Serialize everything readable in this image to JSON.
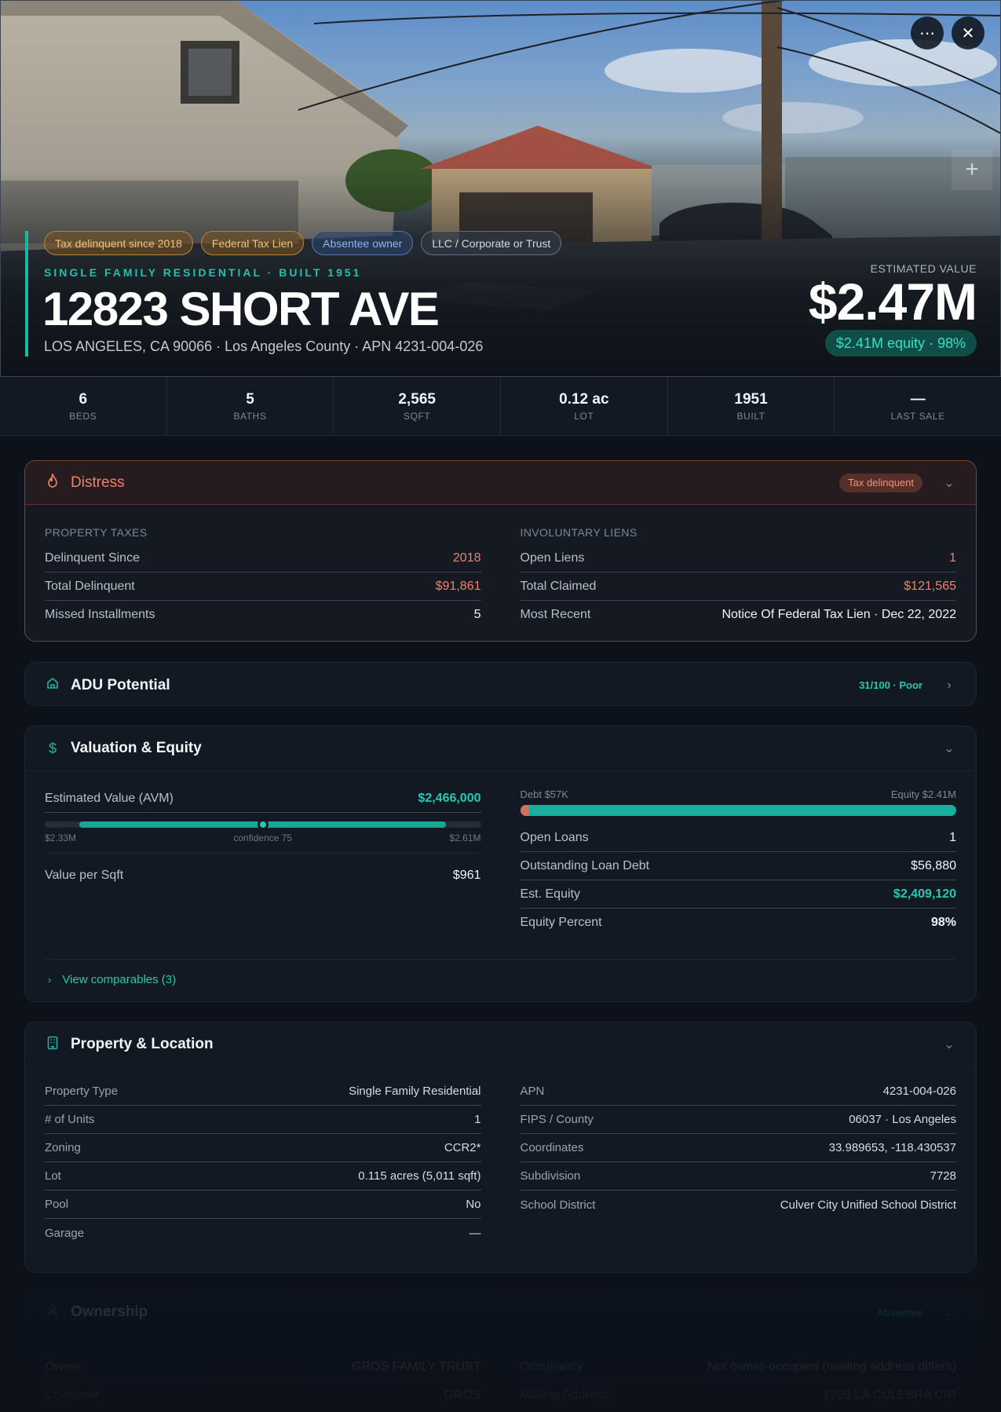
{
  "hero": {
    "tags": [
      {
        "label": "Tax delinquent since 2018",
        "style": "orange"
      },
      {
        "label": "Federal Tax Lien",
        "style": "orange"
      },
      {
        "label": "Absentee owner",
        "style": "blue"
      },
      {
        "label": "LLC / Corporate or Trust",
        "style": "gray"
      }
    ],
    "subtype": "SINGLE FAMILY RESIDENTIAL · BUILT 1951",
    "address": "12823 SHORT AVE",
    "location_line": "LOS ANGELES, CA 90066 · Los Angeles County · APN 4231-004-026",
    "estimated_label": "ESTIMATED VALUE",
    "estimated_value": "$2.47M",
    "equity_pill": "$2.41M equity · 98%",
    "more_icon": "ellipsis-icon",
    "close_icon": "close-icon",
    "zoom_icon": "plus-icon"
  },
  "stats": [
    {
      "value": "6",
      "label": "BEDS"
    },
    {
      "value": "5",
      "label": "BATHS"
    },
    {
      "value": "2,565",
      "label": "SQFT"
    },
    {
      "value": "0.12 ac",
      "label": "LOT"
    },
    {
      "value": "1951",
      "label": "BUILT"
    },
    {
      "value": "—",
      "label": "LAST SALE"
    }
  ],
  "distress": {
    "title": "Distress",
    "badge": "Tax delinquent",
    "icon": "flame-icon",
    "taxes": {
      "label": "PROPERTY TAXES",
      "rows": [
        {
          "k": "Delinquent Since",
          "v": "2018"
        },
        {
          "k": "Total Delinquent",
          "v": "$91,861"
        },
        {
          "k": "Missed Installments",
          "v": "5"
        }
      ]
    },
    "liens": {
      "label": "INVOLUNTARY LIENS",
      "rows": [
        {
          "k": "Open Liens",
          "v": "1"
        },
        {
          "k": "Total Claimed",
          "v": "$121,565"
        },
        {
          "k": "Most Recent",
          "v": "Notice Of Federal Tax Lien · Dec 22, 2022"
        }
      ]
    }
  },
  "adu": {
    "title": "ADU Potential",
    "score": "31/100 · Poor",
    "icon": "home-icon"
  },
  "valuation": {
    "title": "Valuation & Equity",
    "icon": "dollar-icon",
    "avm_label": "Estimated Value (AVM)",
    "avm_value": "$2,466,000",
    "avm_low": "$2.33M",
    "avm_confidence": "confidence 75",
    "avm_high": "$2.61M",
    "vps_label": "Value per Sqft",
    "vps_value": "$961",
    "debt_label": "Debt $57K",
    "equity_label": "Equity $2.41M",
    "debt_fraction": 0.02,
    "rows": [
      {
        "k": "Open Loans",
        "v": "1"
      },
      {
        "k": "Outstanding Loan Debt",
        "v": "$56,880"
      },
      {
        "k": "Est. Equity",
        "v": "$2,409,120"
      },
      {
        "k": "Equity Percent",
        "v": "98%"
      }
    ],
    "comparables_link": "View comparables (3)"
  },
  "property": {
    "title": "Property & Location",
    "icon": "building-icon",
    "left": [
      {
        "k": "Property Type",
        "v": "Single Family Residential"
      },
      {
        "k": "# of Units",
        "v": "1"
      },
      {
        "k": "Zoning",
        "v": "CCR2*"
      },
      {
        "k": "Lot",
        "v": "0.115 acres (5,011 sqft)"
      },
      {
        "k": "Pool",
        "v": "No"
      },
      {
        "k": "Garage",
        "v": "—"
      }
    ],
    "right": [
      {
        "k": "APN",
        "v": "4231-004-026"
      },
      {
        "k": "FIPS / County",
        "v": "06037 · Los Angeles"
      },
      {
        "k": "Coordinates",
        "v": "33.989653, -118.430537"
      },
      {
        "k": "Subdivision",
        "v": "7728"
      },
      {
        "k": "School District",
        "v": "Culver City Unified School District"
      }
    ]
  },
  "ownership": {
    "title": "Ownership",
    "badge": "Absentee",
    "icon": "user-icon",
    "left": [
      {
        "k": "Owner",
        "v": "GROS FAMILY TRUST"
      },
      {
        "k": "Co-owner",
        "v": "GROS"
      }
    ],
    "right": [
      {
        "k": "Occupancy",
        "v": "Not owner-occupied (mailing address differs)"
      },
      {
        "k": "Mailing Address",
        "v": "1229 LA CULEBRA CIR"
      }
    ]
  }
}
